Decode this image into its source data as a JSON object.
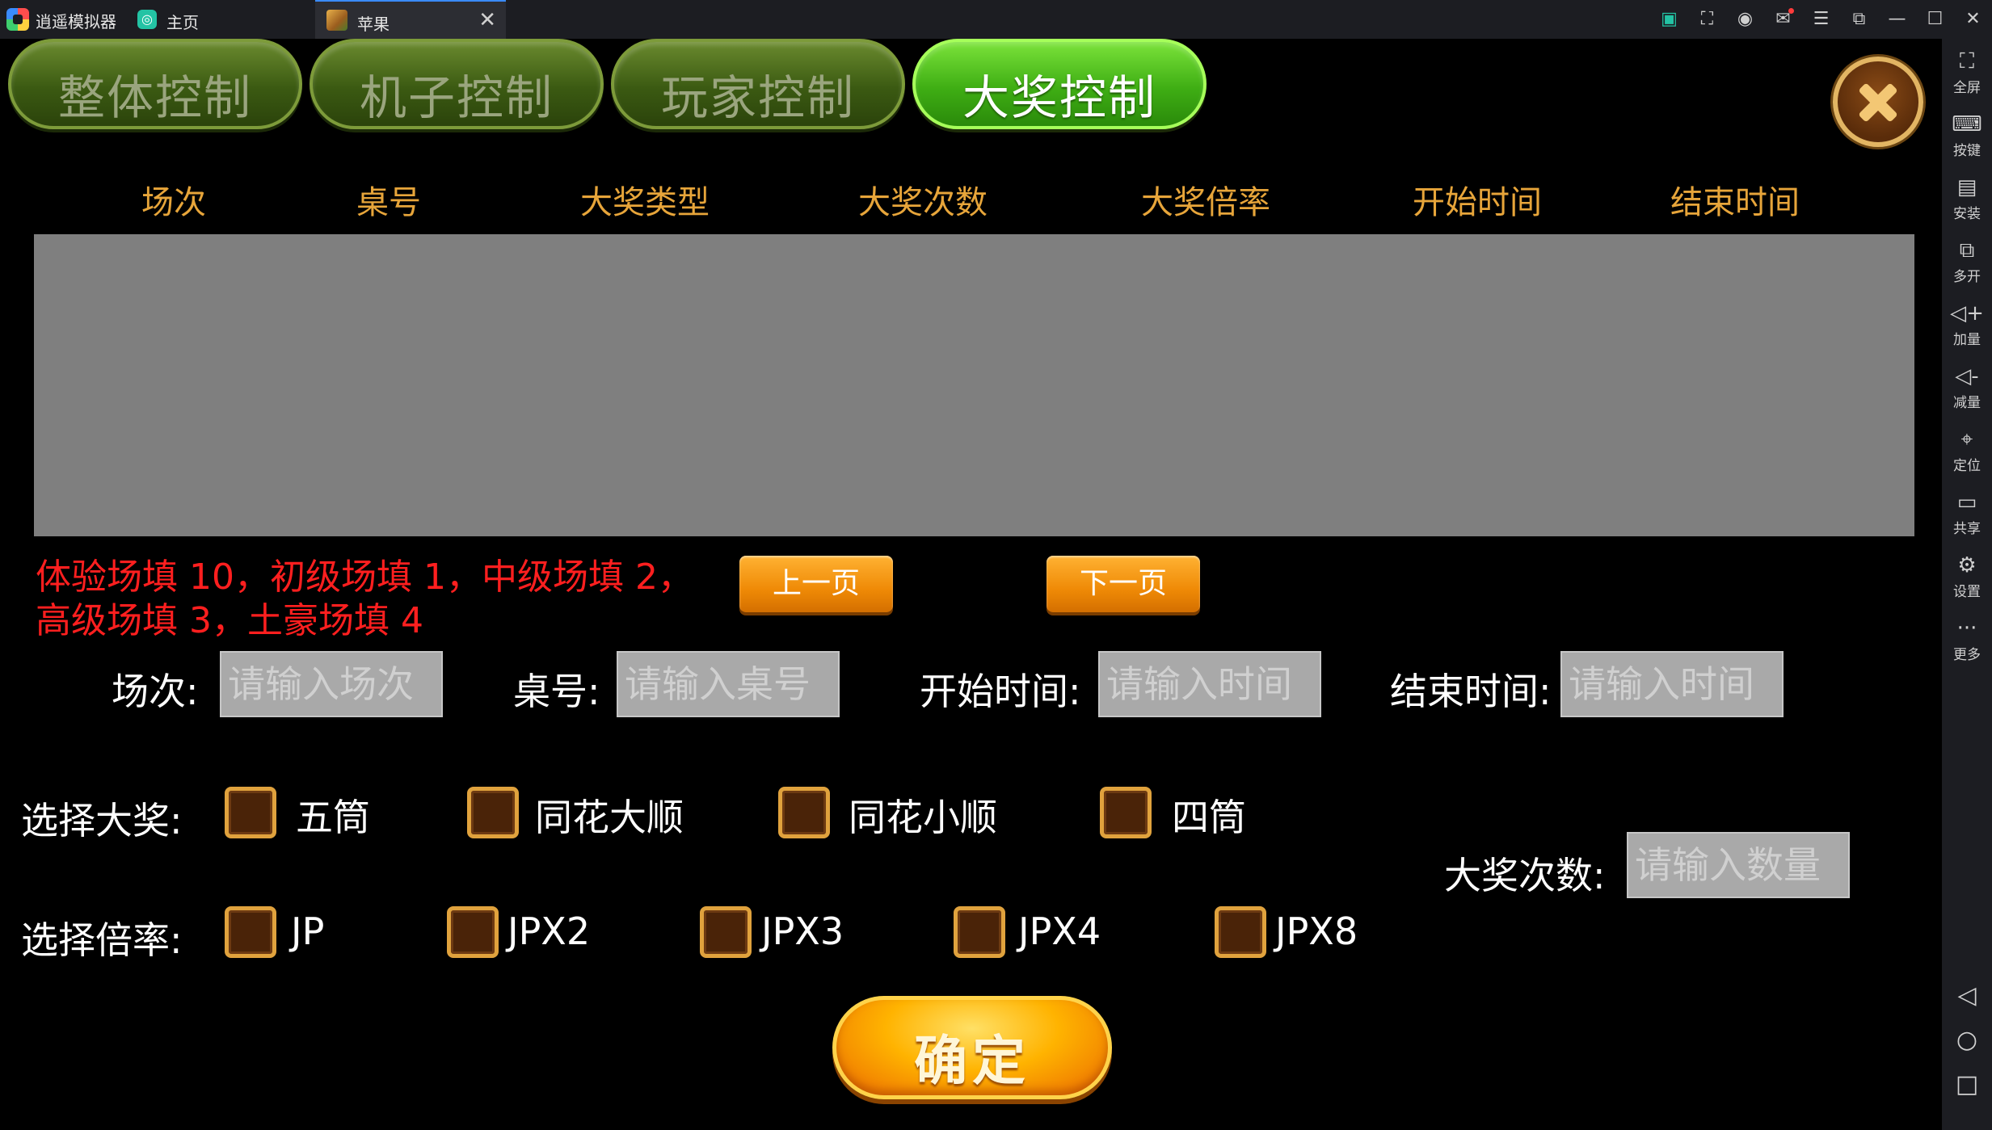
{
  "window": {
    "app_name": "逍遥模拟器",
    "home_tab": "主页",
    "game_tab": "苹果",
    "close_glyph": "✕",
    "toolbar_icons": [
      "keyboard-mapping-icon",
      "screenshot-icon",
      "account-icon",
      "mail-icon",
      "menu-icon",
      "restore-icon",
      "minimize-icon",
      "maximize-icon",
      "close-icon"
    ],
    "toolbar_glyphs": [
      "▣",
      "⛶",
      "◉",
      "✉",
      "☰",
      "⧉",
      "—",
      "☐",
      "✕"
    ]
  },
  "sidebar": {
    "items": [
      {
        "icon": "fullscreen-icon",
        "glyph": "⛶",
        "label": "全屏"
      },
      {
        "icon": "keyboard-icon",
        "glyph": "⌨",
        "label": "按键"
      },
      {
        "icon": "apk-install-icon",
        "glyph": "▤",
        "label": "安装"
      },
      {
        "icon": "multi-instance-icon",
        "glyph": "⧉",
        "label": "多开"
      },
      {
        "icon": "volume-up-icon",
        "glyph": "◁+",
        "label": "加量"
      },
      {
        "icon": "volume-down-icon",
        "glyph": "◁-",
        "label": "减量"
      },
      {
        "icon": "location-icon",
        "glyph": "⌖",
        "label": "定位"
      },
      {
        "icon": "folder-share-icon",
        "glyph": "▭",
        "label": "共享"
      },
      {
        "icon": "settings-icon",
        "glyph": "⚙",
        "label": "设置"
      },
      {
        "icon": "more-icon",
        "glyph": "···",
        "label": "更多"
      }
    ],
    "nav": [
      {
        "icon": "back-icon",
        "glyph": "◁"
      },
      {
        "icon": "home-icon",
        "glyph": "○"
      },
      {
        "icon": "recents-icon",
        "glyph": "□"
      }
    ]
  },
  "tabs": [
    {
      "label": "整体控制",
      "active": false
    },
    {
      "label": "机子控制",
      "active": false
    },
    {
      "label": "玩家控制",
      "active": false
    },
    {
      "label": "大奖控制",
      "active": true
    }
  ],
  "table": {
    "columns": [
      "场次",
      "桌号",
      "大奖类型",
      "大奖次数",
      "大奖倍率",
      "开始时间",
      "结束时间"
    ],
    "rows": []
  },
  "hint": {
    "line1": "体验场填 10，初级场填 1，中级场填 2，",
    "line2": "高级场填 3，土豪场填 4"
  },
  "pagination": {
    "prev": "上一页",
    "next": "下一页"
  },
  "filters": {
    "session_label": "场次:",
    "session_placeholder": "请输入场次",
    "table_label": "桌号:",
    "table_placeholder": "请输入桌号",
    "start_label": "开始时间:",
    "start_placeholder": "请输入时间",
    "end_label": "结束时间:",
    "end_placeholder": "请输入时间"
  },
  "jackpot": {
    "label": "选择大奖:",
    "options": [
      "五筒",
      "同花大顺",
      "同花小顺",
      "四筒"
    ],
    "count_label": "大奖次数:",
    "count_placeholder": "请输入数量"
  },
  "multiplier": {
    "label": "选择倍率:",
    "options": [
      "JP",
      "JPX2",
      "JPX3",
      "JPX4",
      "JPX8"
    ]
  },
  "confirm": "确定"
}
